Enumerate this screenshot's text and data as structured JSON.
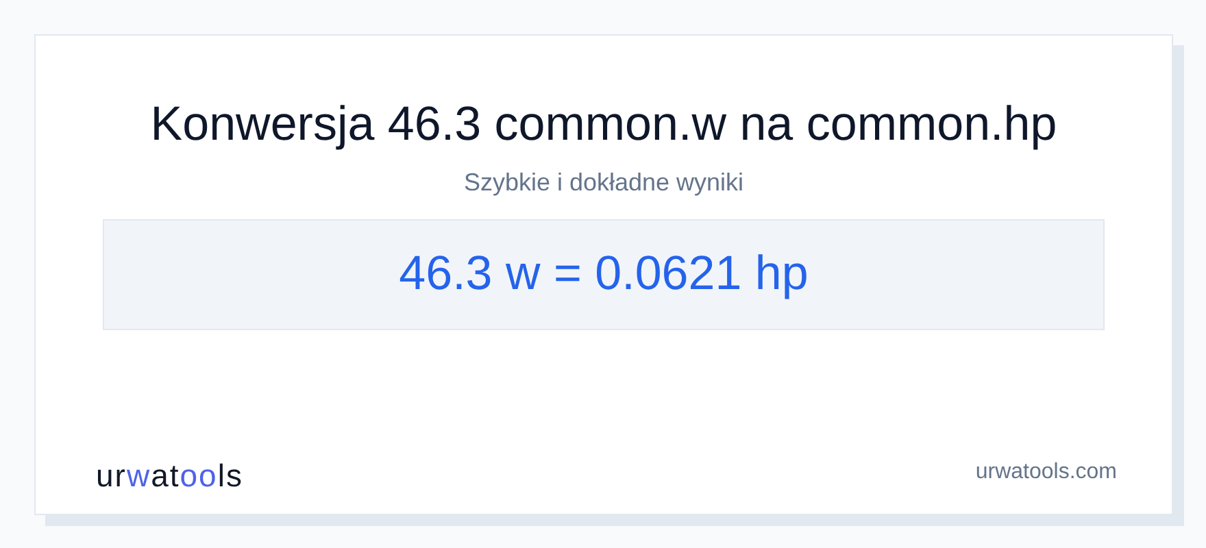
{
  "title": "Konwersja 46.3 common.w na common.hp",
  "subtitle": "Szybkie i dokładne wyniki",
  "result": "46.3 w = 0.0621 hp",
  "logo": [
    {
      "text": "ur",
      "accent": false
    },
    {
      "text": "w",
      "accent": true
    },
    {
      "text": "at",
      "accent": false
    },
    {
      "text": "oo",
      "accent": true
    },
    {
      "text": "ls",
      "accent": false
    }
  ],
  "site": "urwatools.com"
}
